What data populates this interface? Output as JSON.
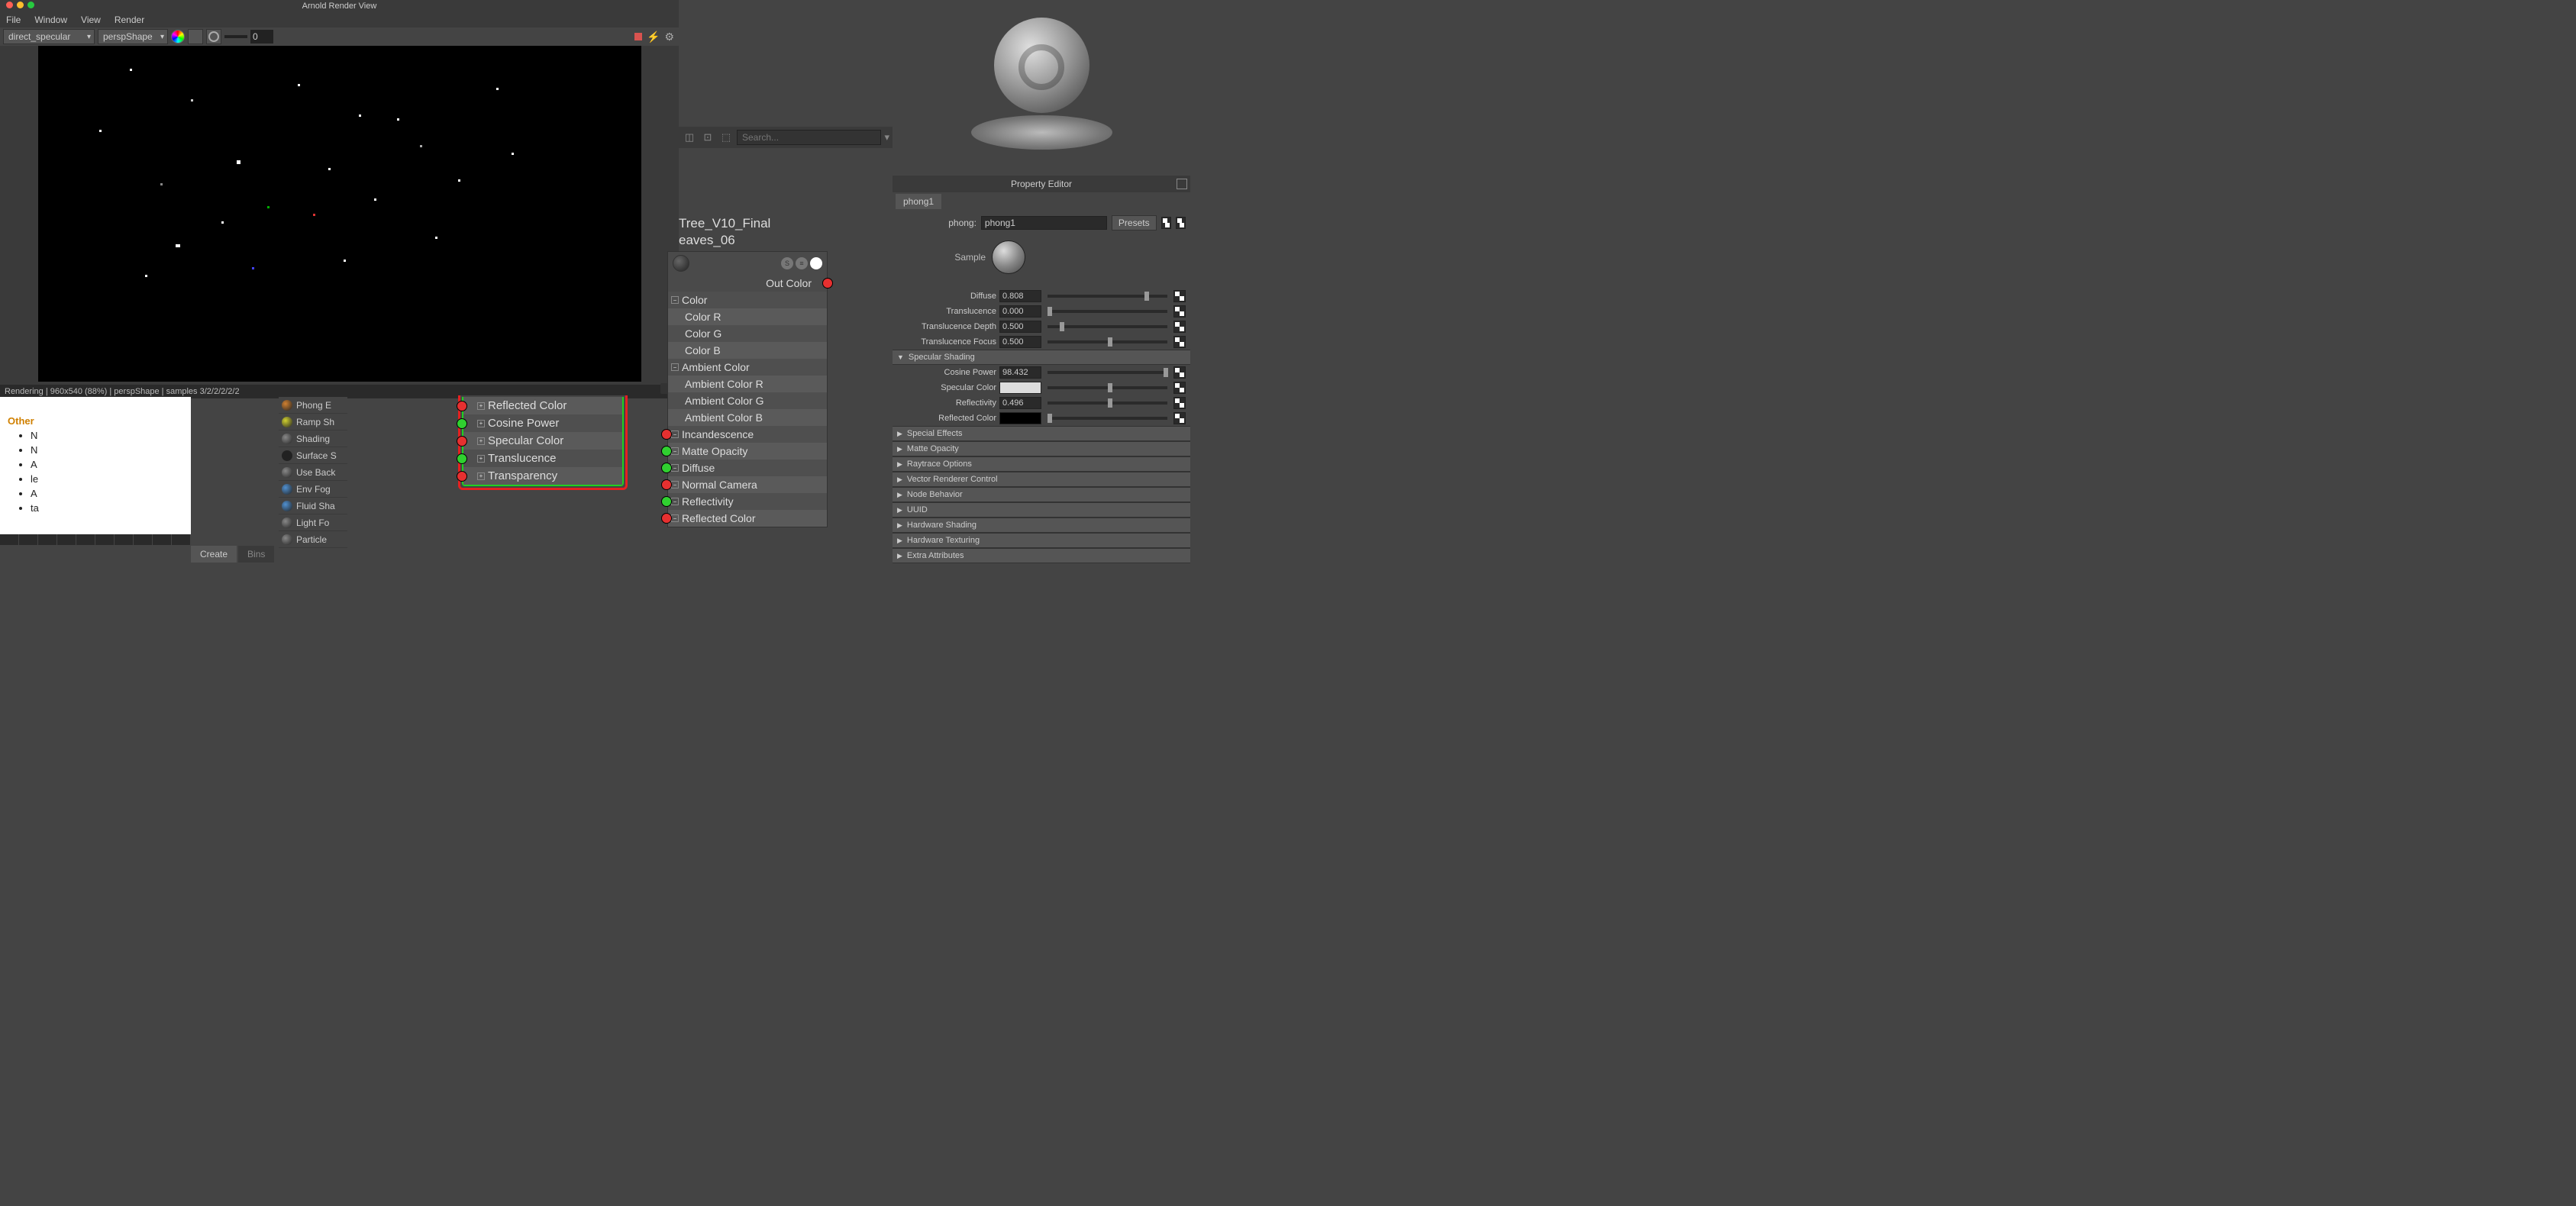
{
  "arnold": {
    "title": "Arnold Render View",
    "menus": [
      "File",
      "Window",
      "View",
      "Render"
    ],
    "aov_dropdown": "direct_specular",
    "camera_dropdown": "perspShape",
    "spinner_value": "0",
    "status": "Rendering | 960x540 (88%) | perspShape  | samples 3/2/2/2/2/2"
  },
  "search": {
    "placeholder": "Search..."
  },
  "node": {
    "title_line1": "Tree_V10_Final",
    "title_line2": "eaves_06",
    "out_color": "Out Color",
    "attrs": [
      {
        "label": "Color",
        "port": "none"
      },
      {
        "label": "Color R",
        "sub": true
      },
      {
        "label": "Color G",
        "sub": true
      },
      {
        "label": "Color B",
        "sub": true
      },
      {
        "label": "Ambient Color",
        "port": "none"
      },
      {
        "label": "Ambient Color R",
        "sub": true
      },
      {
        "label": "Ambient Color G",
        "sub": true
      },
      {
        "label": "Ambient Color B",
        "sub": true
      },
      {
        "label": "Incandescence",
        "port": "red"
      },
      {
        "label": "Matte Opacity",
        "port": "green"
      },
      {
        "label": "Diffuse",
        "port": "green"
      },
      {
        "label": "Normal Camera",
        "port": "red"
      },
      {
        "label": "Reflectivity",
        "port": "green"
      },
      {
        "label": "Reflected Color",
        "port": "red"
      }
    ]
  },
  "left_attrs": [
    {
      "label": "Reflected Color",
      "port": "red"
    },
    {
      "label": "Cosine Power",
      "port": "green"
    },
    {
      "label": "Specular Color",
      "port": "red"
    },
    {
      "label": "Translucence",
      "port": "green"
    },
    {
      "label": "Transparency",
      "port": "red"
    }
  ],
  "white_panel": {
    "heading": "Other",
    "items": [
      "N",
      "N",
      "A",
      "le",
      "A",
      "ta"
    ]
  },
  "shader_list": [
    {
      "label": "Phong E",
      "color": "#d08030"
    },
    {
      "label": "Ramp Sh",
      "color": "#d0d030"
    },
    {
      "label": "Shading",
      "color": "#888"
    },
    {
      "label": "Surface S",
      "color": "#222"
    },
    {
      "label": "Use Back",
      "color": "#888"
    },
    {
      "label": "Env Fog",
      "color": "#5090d0"
    },
    {
      "label": "Fluid Sha",
      "color": "#5090d0"
    },
    {
      "label": "Light Fo",
      "color": "#888"
    },
    {
      "label": "Particle",
      "color": "#888"
    }
  ],
  "tabs": {
    "create": "Create",
    "bins": "Bins"
  },
  "prop": {
    "title": "Property Editor",
    "tab": "phong1",
    "type_label": "phong:",
    "name": "phong1",
    "presets": "Presets",
    "sample_label": "Sample",
    "params": [
      {
        "label": "Diffuse",
        "value": "0.808",
        "slider": 0.81
      },
      {
        "label": "Translucence",
        "value": "0.000",
        "slider": 0.0
      },
      {
        "label": "Translucence Depth",
        "value": "0.500",
        "slider": 0.1
      },
      {
        "label": "Translucence Focus",
        "value": "0.500",
        "slider": 0.5
      }
    ],
    "specular_header": "Specular Shading",
    "specular_params": [
      {
        "label": "Cosine Power",
        "value": "98.432",
        "slider": 0.97
      },
      {
        "label": "Specular Color",
        "swatch": "#dddddd",
        "slider": 0.5
      },
      {
        "label": "Reflectivity",
        "value": "0.496",
        "slider": 0.5
      },
      {
        "label": "Reflected Color",
        "swatch": "#000000",
        "slider": 0.0
      }
    ],
    "sections": [
      "Special Effects",
      "Matte Opacity",
      "Raytrace Options",
      "Vector Renderer Control",
      "Node Behavior",
      "UUID",
      "Hardware Shading",
      "Hardware Texturing",
      "Extra Attributes"
    ]
  }
}
